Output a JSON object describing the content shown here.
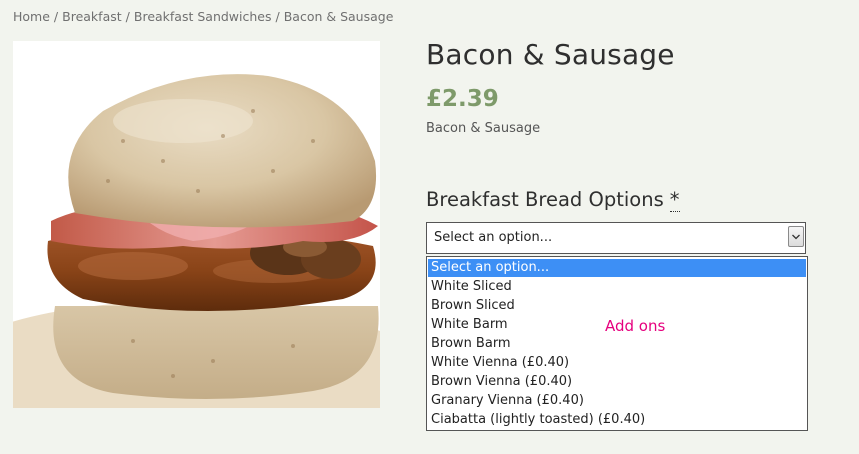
{
  "breadcrumb": {
    "items": [
      "Home",
      "Breakfast",
      "Breakfast Sandwiches",
      "Bacon & Sausage"
    ],
    "separator": "/"
  },
  "product": {
    "title": "Bacon & Sausage",
    "price": "£2.39",
    "short_description": "Bacon & Sausage",
    "image_alt": "bacon-and-sausage-bun-photo"
  },
  "options": {
    "label": "Breakfast Bread Options",
    "required_marker": "*",
    "select_value": "Select an option...",
    "items": [
      "Select an option...",
      "White Sliced",
      "Brown Sliced",
      "White Barm",
      "Brown Barm",
      "White Vienna (£0.40)",
      "Brown Vienna (£0.40)",
      "Granary Vienna (£0.40)",
      "Ciabatta (lightly toasted) (£0.40)"
    ]
  },
  "annotation": {
    "text": "Add ons",
    "color": "#e6007e"
  },
  "colors": {
    "price": "#7e9a6a",
    "background": "#f2f4ee",
    "selected_option": "#3d8ff5"
  }
}
